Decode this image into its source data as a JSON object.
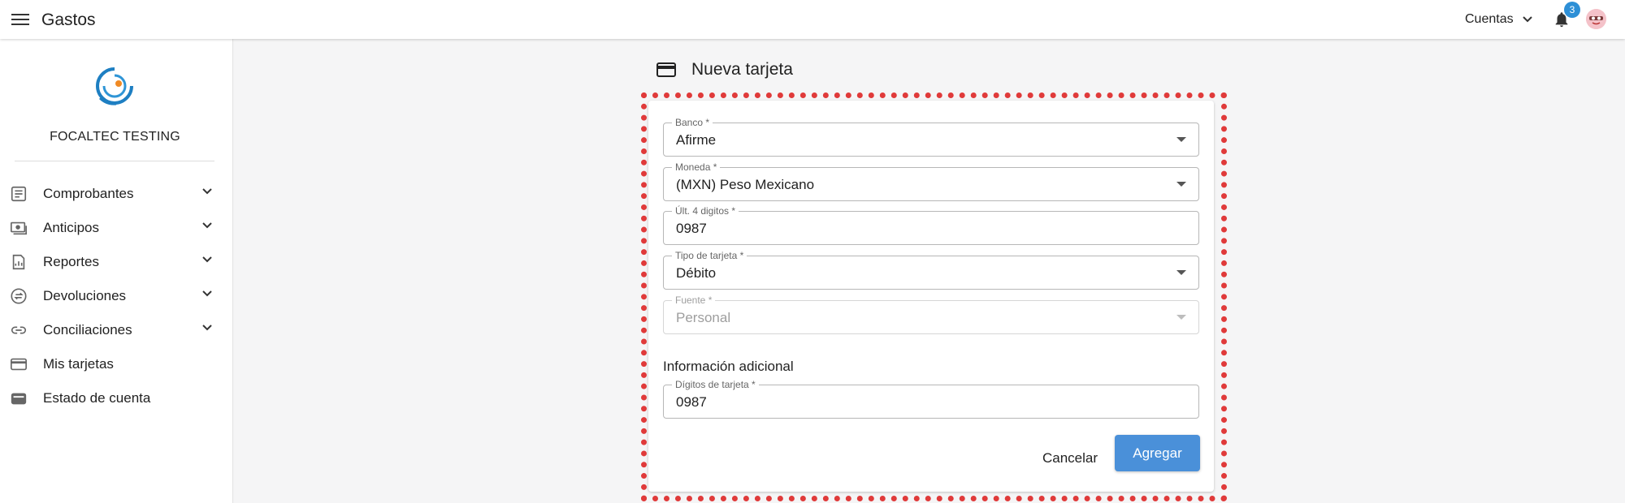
{
  "header": {
    "app_title": "Gastos",
    "accounts_label": "Cuentas",
    "notifications_count": "3"
  },
  "sidebar": {
    "company_name": "FOCALTEC TESTING",
    "items": [
      {
        "label": "Comprobantes",
        "icon": "receipt-icon",
        "expandable": true
      },
      {
        "label": "Anticipos",
        "icon": "cash-icon",
        "expandable": true
      },
      {
        "label": "Reportes",
        "icon": "report-icon",
        "expandable": true
      },
      {
        "label": "Devoluciones",
        "icon": "refund-icon",
        "expandable": true
      },
      {
        "label": "Conciliaciones",
        "icon": "link-icon",
        "expandable": true
      },
      {
        "label": "Mis tarjetas",
        "icon": "credit-card-icon",
        "expandable": false
      },
      {
        "label": "Estado de cuenta",
        "icon": "wallet-icon",
        "expandable": false
      }
    ]
  },
  "page": {
    "title": "Nueva tarjeta"
  },
  "form": {
    "bank": {
      "label": "Banco *",
      "value": "Afirme"
    },
    "currency": {
      "label": "Moneda *",
      "value": "(MXN) Peso Mexicano"
    },
    "last_digits": {
      "label": "Últ. 4 digitos *",
      "value": "0987"
    },
    "card_type": {
      "label": "Tipo de tarjeta *",
      "value": "Débito"
    },
    "source": {
      "label": "Fuente *",
      "value": "Personal"
    },
    "additional_title": "Información adicional",
    "card_digits": {
      "label": "Dígitos de tarjeta *",
      "value": "0987"
    },
    "cancel_label": "Cancelar",
    "submit_label": "Agregar"
  },
  "colors": {
    "accent": "#4a90d9",
    "badge": "#2d8fd6",
    "highlight_border": "#e03a3a"
  }
}
